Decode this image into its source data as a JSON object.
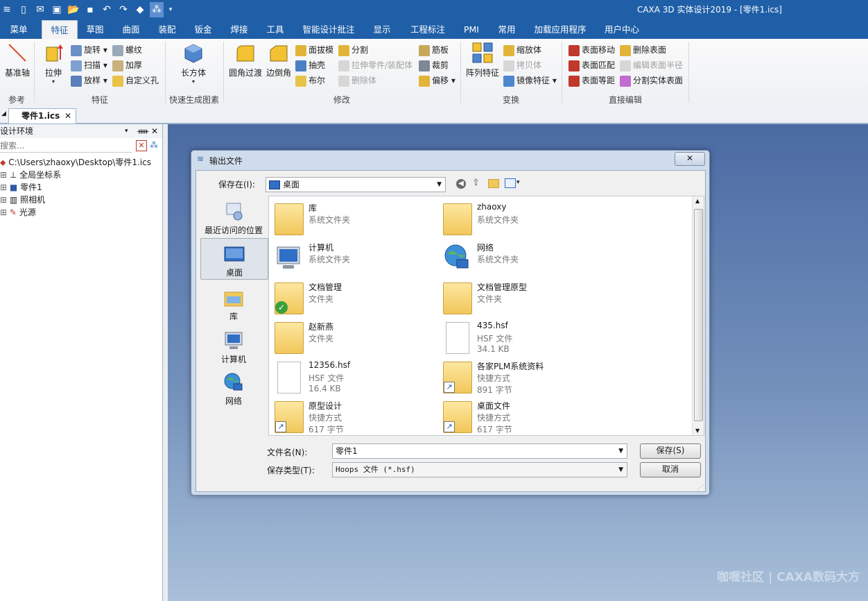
{
  "titlebar": {
    "title": "CAXA 3D 实体设计2019 - [零件1.ics]",
    "accent": "#1f5fa8"
  },
  "menu_tabs": [
    "菜单",
    "特征",
    "草图",
    "曲面",
    "装配",
    "钣金",
    "焊接",
    "工具",
    "智能设计批注",
    "显示",
    "工程标注",
    "PMI",
    "常用",
    "加载应用程序",
    "用户中心"
  ],
  "ribbon": {
    "ref_axis": "基准轴",
    "group_ref": "参考",
    "extrude": "拉伸",
    "rotate": "旋转",
    "sweep": "扫描",
    "loft": "放样",
    "thread": "螺纹",
    "thicken": "加厚",
    "custom_hole": "自定义孔",
    "group_feature": "特征",
    "box": "长方体",
    "group_quick": "快速生成图素",
    "fillet": "圆角过渡",
    "chamfer": "边倒角",
    "draft": "面拔模",
    "shell": "抽壳",
    "boolean": "布尔",
    "split": "分割",
    "stretch_part": "拉伸零件/装配体",
    "delete_body": "删除体",
    "rib": "筋板",
    "trim": "裁剪",
    "offset": "偏移",
    "group_modify": "修改",
    "pattern": "阵列特征",
    "scale": "缩放体",
    "copy_body": "拷贝体",
    "mirror": "镜像特征",
    "group_transform": "变换",
    "face_move": "表面移动",
    "face_match": "表面匹配",
    "face_equidist": "表面等距",
    "delete_face": "删除表面",
    "edit_radius": "编辑表面半径",
    "split_face": "分割实体表面",
    "group_direct": "直接编辑"
  },
  "doc_tab": "零件1.ics",
  "left_panel": {
    "title": "设计环境",
    "search_placeholder": "搜索...",
    "tree": [
      "C:\\Users\\zhaoxy\\Desktop\\零件1.ics",
      "全局坐标系",
      "零件1",
      "照相机",
      "光源"
    ]
  },
  "dialog": {
    "title": "输出文件",
    "save_in_label": "保存在(I):",
    "save_in_value": "桌面",
    "places": [
      "最近访问的位置",
      "桌面",
      "库",
      "计算机",
      "网络"
    ],
    "files": [
      {
        "name": "库",
        "type": "系统文件夹",
        "size": ""
      },
      {
        "name": "zhaoxy",
        "type": "系统文件夹",
        "size": ""
      },
      {
        "name": "计算机",
        "type": "系统文件夹",
        "size": ""
      },
      {
        "name": "网络",
        "type": "系统文件夹",
        "size": ""
      },
      {
        "name": "文档管理",
        "type": "文件夹",
        "size": ""
      },
      {
        "name": "文档管理原型",
        "type": "文件夹",
        "size": ""
      },
      {
        "name": "赵新燕",
        "type": "文件夹",
        "size": ""
      },
      {
        "name": "435.hsf",
        "type": "HSF 文件",
        "size": "34.1 KB"
      },
      {
        "name": "12356.hsf",
        "type": "HSF 文件",
        "size": "16.4 KB"
      },
      {
        "name": "各家PLM系统资料",
        "type": "快捷方式",
        "size": "891 字节"
      },
      {
        "name": "原型设计",
        "type": "快捷方式",
        "size": "617 字节"
      },
      {
        "name": "桌面文件",
        "type": "快捷方式",
        "size": "617 字节"
      }
    ],
    "filename_label": "文件名(N):",
    "filename_value": "零件1",
    "filetype_label": "保存类型(T):",
    "filetype_value": "Hoops 文件 (*.hsf)",
    "save_button": "保存(S)",
    "cancel_button": "取消"
  },
  "watermark": "咖喱社区 | CAXA数码大方"
}
